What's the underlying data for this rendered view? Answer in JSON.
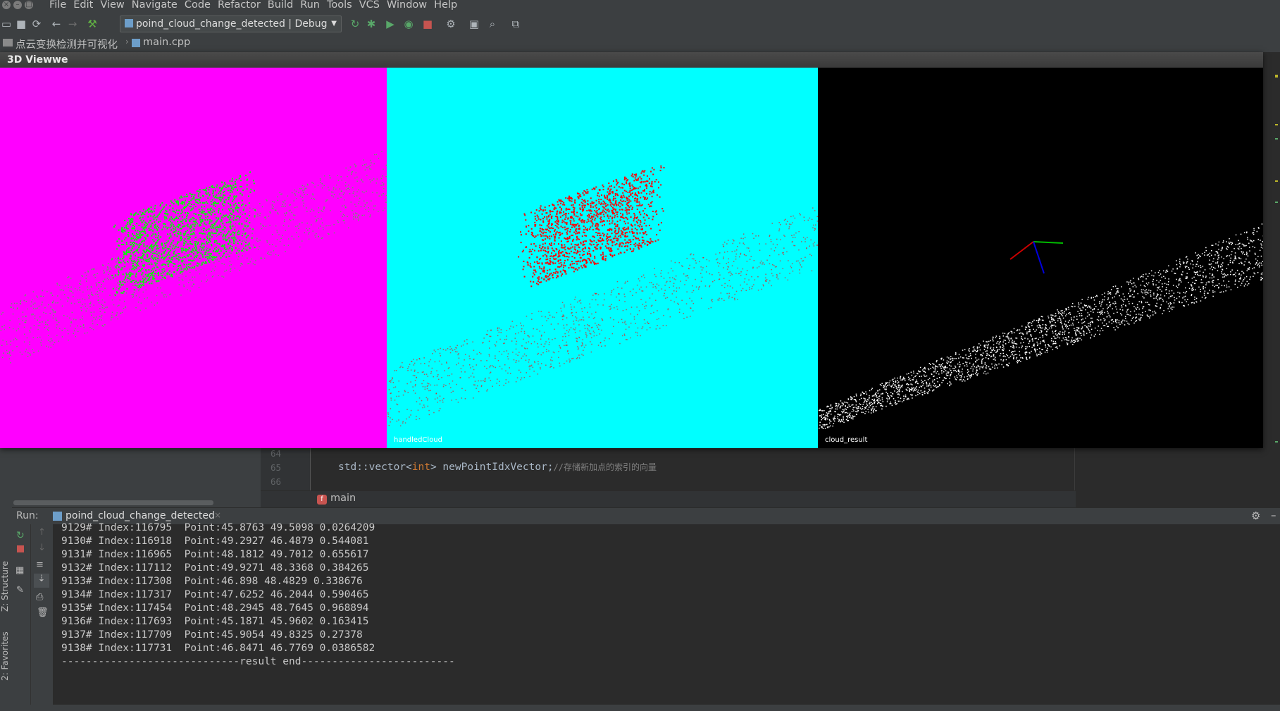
{
  "menubar": {
    "items": [
      "File",
      "Edit",
      "View",
      "Navigate",
      "Code",
      "Refactor",
      "Build",
      "Run",
      "Tools",
      "VCS",
      "Window",
      "Help"
    ]
  },
  "toolbar": {
    "run_config": "poind_cloud_change_detected | Debug"
  },
  "navbar": {
    "project": "点云变换检测并可视化",
    "file": "main.cpp"
  },
  "viewer": {
    "title": "3D Viewwe",
    "viewports": [
      {
        "label": "",
        "background": "#ff00ff",
        "cloud_color": "#00ff00"
      },
      {
        "label": "handledCloud",
        "background": "#00ffff",
        "cloud_color": "#ff0000"
      },
      {
        "label": "cloud_result",
        "background": "#000000",
        "cloud_color": "#ffffff"
      }
    ]
  },
  "editor": {
    "line_numbers": [
      "64",
      "65",
      "66"
    ],
    "code_line": {
      "type": "std::vector<",
      "keyword": "int",
      "rest": "> newPointIdxVector;",
      "comment": "//存储新加点的索引的向量"
    },
    "breadcrumb_function": "main"
  },
  "run": {
    "label": "Run:",
    "tab": "poind_cloud_change_detected",
    "console_lines": [
      "9129# Index:116795  Point:45.8763 49.5098 0.0264209",
      "9130# Index:116918  Point:49.2927 46.4879 0.544081",
      "9131# Index:116965  Point:48.1812 49.7012 0.655617",
      "9132# Index:117112  Point:49.9271 48.3368 0.384265",
      "9133# Index:117308  Point:46.898 48.4829 0.338676",
      "9134# Index:117317  Point:47.6252 46.2044 0.590465",
      "9135# Index:117454  Point:48.2945 48.7645 0.968894",
      "9136# Index:117693  Point:45.1871 45.9602 0.163415",
      "9137# Index:117709  Point:45.9054 49.8325 0.27378",
      "9138# Index:117731  Point:46.8471 46.7769 0.0386582",
      "-----------------------------result end-------------------------"
    ]
  },
  "side_tabs": {
    "structure": "Z: Structure",
    "favorites": "2: Favorites"
  }
}
